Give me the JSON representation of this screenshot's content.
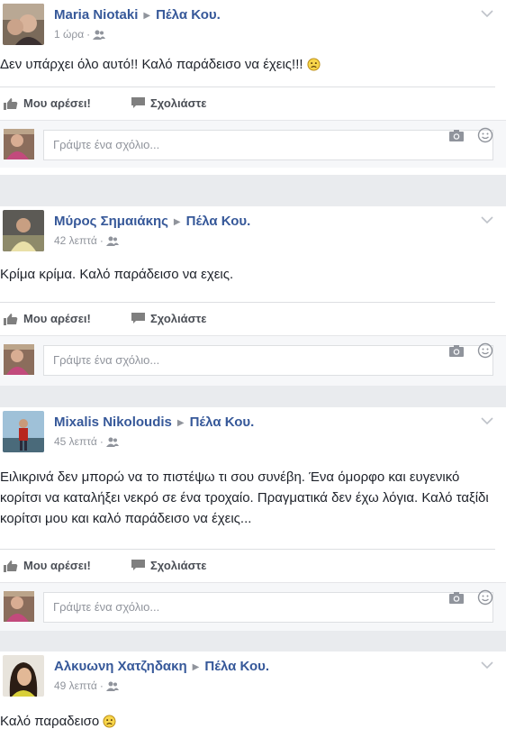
{
  "action_labels": {
    "like": "Μου αρέσει!",
    "comment": "Σχολιάστε"
  },
  "comment_placeholder": "Γράψτε ένα σχόλιο...",
  "colors": {
    "link": "#365899",
    "meta": "#90949c",
    "feed_bg": "#e9ebee"
  },
  "posts": [
    {
      "author": "Maria Niotaki",
      "target": "Πέλα Κου.",
      "time": "1 ώρα",
      "text": "Δεν υπάρχει όλο αυτό!! Καλό παράδεισο να έχεις!!!",
      "emoji": "sad-face-icon"
    },
    {
      "author": "Μύρος Σημαιάκης",
      "target": "Πέλα Κου.",
      "time": "42 λεπτά",
      "text": "Κρίμα κρίμα. Καλό παράδεισο να εχεις."
    },
    {
      "author": "Mixalis Nikoloudis",
      "target": "Πέλα Κου.",
      "time": "45 λεπτά",
      "text": "Ειλικρινά δεν μπορώ να το πιστέψω τι σου συνέβη. Ένα όμορφο και ευγενικό κορίτσι να καταλήξει νεκρό σε ένα τροχαίο. Πραγματικά δεν έχω λόγια. Καλό ταξίδι κορίτσι μου και καλό παράδεισο να έχεις..."
    },
    {
      "author": "Αλκυωνη Χατζηδακη",
      "target": "Πέλα Κου.",
      "time": "49 λεπτά",
      "text": "Καλό παραδεισο",
      "emoji": "sad-face-icon"
    }
  ]
}
